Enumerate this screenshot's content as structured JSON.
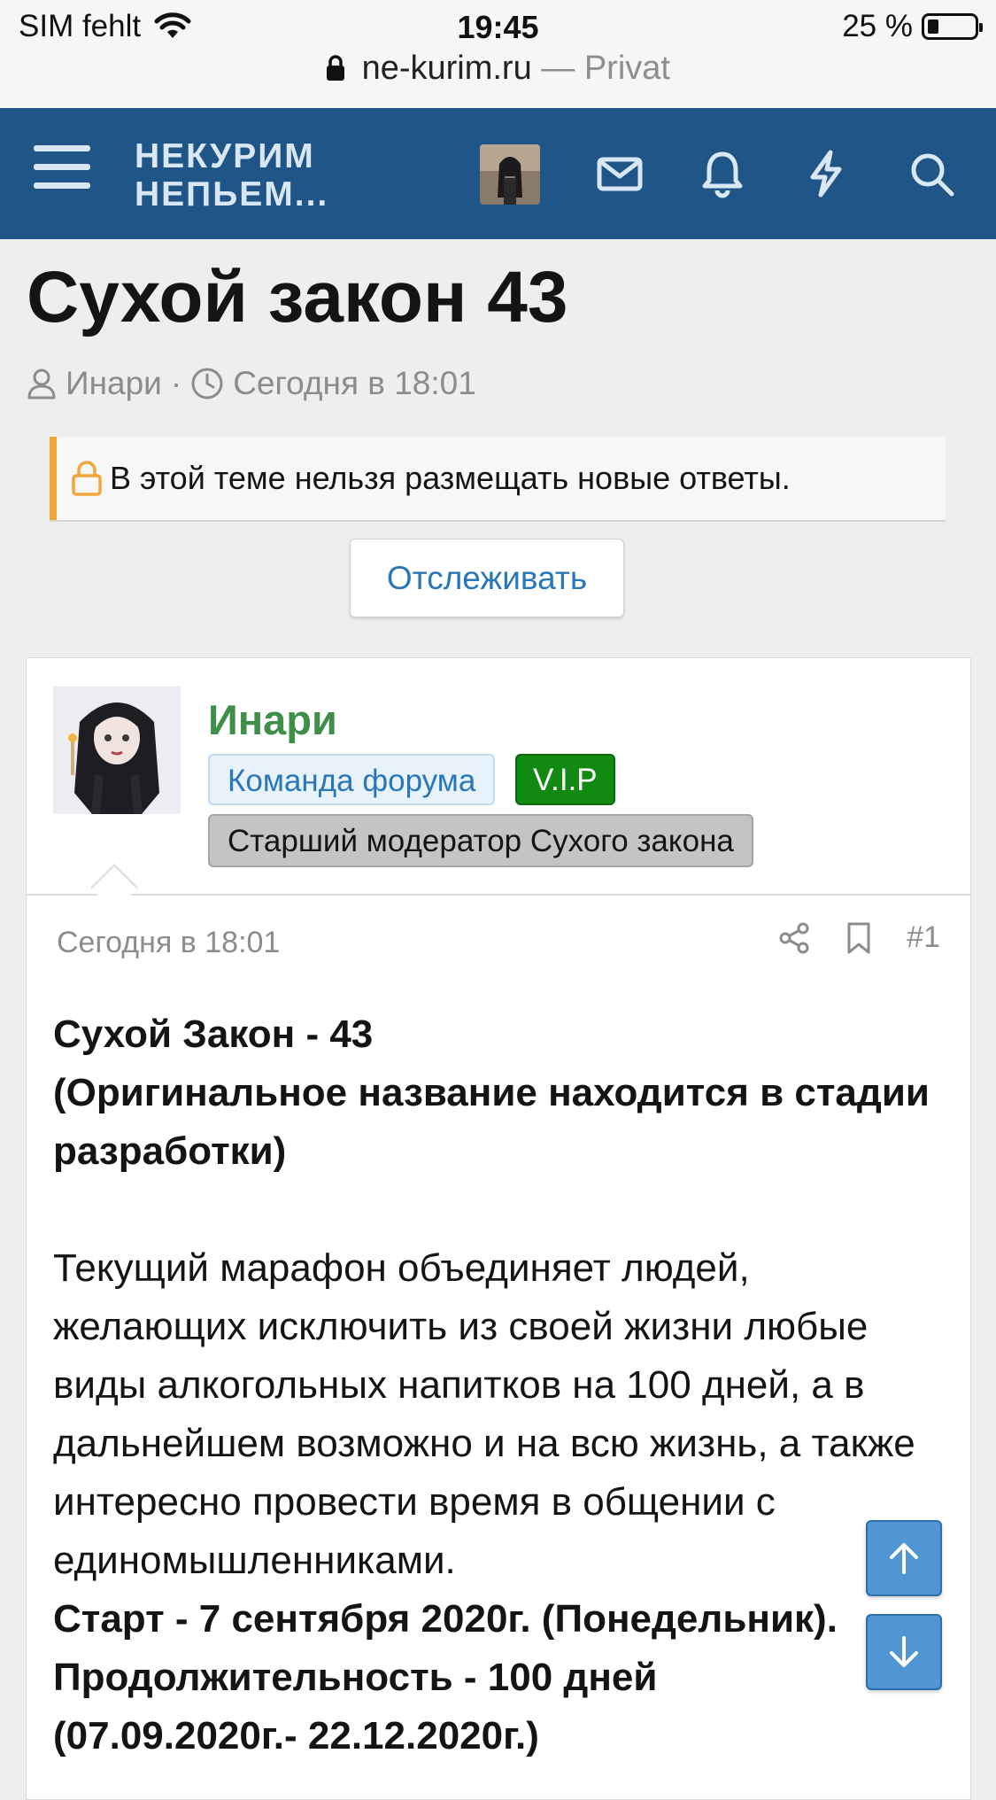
{
  "status_bar": {
    "carrier": "SIM fehlt",
    "time": "19:45",
    "battery": "25 %",
    "battery_level": 0.25
  },
  "url_bar": {
    "domain": "ne-kurim.ru",
    "mode": "— Privat"
  },
  "header": {
    "logo_line1": "НЕКУРИМ",
    "logo_line2": "НЕПЬЕМ..."
  },
  "thread": {
    "title": "Сухой закон 43",
    "author": "Инари",
    "separator": "·",
    "date": "Сегодня в 18:01",
    "locked_notice": "В этой теме нельзя размещать новые ответы.",
    "watch_button": "Отслеживать"
  },
  "post": {
    "username": "Инари",
    "badges": {
      "team": "Команда форума",
      "vip": "V.I.P",
      "role": "Старший модератор Сухого закона"
    },
    "date": "Сегодня в 18:01",
    "number": "#1",
    "body": {
      "heading_line1": "Сухой Закон - 43",
      "heading_line2": "(Оригинальное название находится в стадии разработки)",
      "paragraph": "Текущий марафон объединяет людей, желающих исключить из своей жизни любые виды алкогольных напитков на 100 дней, а в дальнейшем возможно и на всю жизнь, а также интересно провести время в общении с единомышленниками.",
      "start_line": "Старт - 7 сентября 2020г. (Понедельник).",
      "duration_line": "Продолжительность - 100 дней",
      "dates_line": "(07.09.2020г.- 22.12.2020г.)"
    }
  },
  "colors": {
    "header_bg": "#1f5587",
    "username": "#3f8f4a",
    "link": "#2a77b8",
    "notice_accent": "#f2a53a",
    "vip_bg": "#118a12"
  }
}
